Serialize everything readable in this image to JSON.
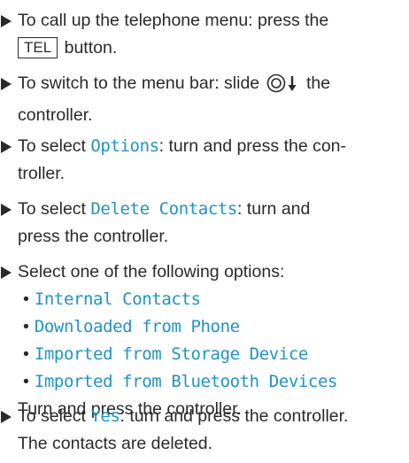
{
  "steps": [
    {
      "line1_before": "To call up the telephone menu: press the",
      "key_label": "TEL",
      "line2_after": " button."
    },
    {
      "line1_before": "To switch to the menu bar: slide",
      "line1_after": "the",
      "line2": "controller."
    },
    {
      "line1_before": "To select ",
      "option": "Options",
      "line1_after": ": turn and press the con-",
      "line2": "troller."
    },
    {
      "line1_before": "To select ",
      "option": "Delete Contacts",
      "line1_after": ": turn and",
      "line2": "press the controller."
    },
    {
      "intro": "Select one of the following options:",
      "options": [
        "Internal Contacts",
        "Downloaded from Phone",
        "Imported from Storage Device",
        "Imported from Bluetooth Devices"
      ],
      "outro": "Turn and press the controller."
    },
    {
      "line1_before": "To select ",
      "option": "Yes",
      "line1_after": ": turn and press the controller.",
      "line2": "The contacts are deleted."
    }
  ]
}
